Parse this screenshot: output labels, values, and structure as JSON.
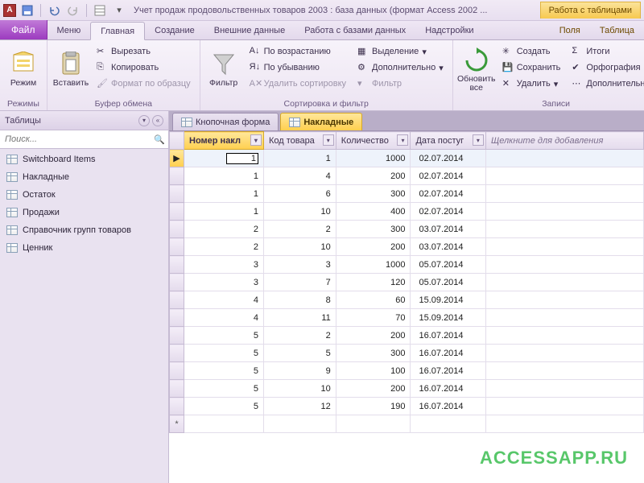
{
  "title": "Учет продаж продовольственных товаров 2003 : база данных (формат Access 2002 ...",
  "context_title": "Работа с таблицами",
  "tabs": {
    "file": "Файл",
    "items": [
      "Меню",
      "Главная",
      "Создание",
      "Внешние данные",
      "Работа с базами данных",
      "Надстройки"
    ],
    "context": [
      "Поля",
      "Таблица"
    ],
    "active": "Главная"
  },
  "ribbon": {
    "views": {
      "label": "Режимы",
      "btn": "Режим"
    },
    "clipboard": {
      "label": "Буфер обмена",
      "paste": "Вставить",
      "cut": "Вырезать",
      "copy": "Копировать",
      "format": "Формат по образцу"
    },
    "sortfilter": {
      "label": "Сортировка и фильтр",
      "filter": "Фильтр",
      "asc": "По возрастанию",
      "desc": "По убыванию",
      "clear": "Удалить сортировку",
      "selection": "Выделение",
      "advanced": "Дополнительно",
      "toggle": "Фильтр"
    },
    "records": {
      "label": "Записи",
      "refresh": "Обновить\nвсе",
      "new": "Создать",
      "save": "Сохранить",
      "delete": "Удалить",
      "totals": "Итоги",
      "spell": "Орфография",
      "more": "Дополнительно"
    }
  },
  "nav": {
    "header": "Таблицы",
    "search_placeholder": "Поиск...",
    "items": [
      "Switchboard Items",
      "Накладные",
      "Остаток",
      "Продажи",
      "Справочник групп товаров",
      "Ценник"
    ]
  },
  "doc_tabs": [
    {
      "label": "Кнопочная форма",
      "active": false
    },
    {
      "label": "Накладные",
      "active": true
    }
  ],
  "grid": {
    "columns": [
      "Номер накл",
      "Код товара",
      "Количество",
      "Дата постуг"
    ],
    "addcol": "Щелкните для добавления",
    "active_cell": "1",
    "rows": [
      [
        "",
        "1",
        "1000",
        "02.07.2014"
      ],
      [
        "1",
        "4",
        "200",
        "02.07.2014"
      ],
      [
        "1",
        "6",
        "300",
        "02.07.2014"
      ],
      [
        "1",
        "10",
        "400",
        "02.07.2014"
      ],
      [
        "2",
        "2",
        "300",
        "03.07.2014"
      ],
      [
        "2",
        "10",
        "200",
        "03.07.2014"
      ],
      [
        "3",
        "3",
        "1000",
        "05.07.2014"
      ],
      [
        "3",
        "7",
        "120",
        "05.07.2014"
      ],
      [
        "4",
        "8",
        "60",
        "15.09.2014"
      ],
      [
        "4",
        "11",
        "70",
        "15.09.2014"
      ],
      [
        "5",
        "2",
        "200",
        "16.07.2014"
      ],
      [
        "5",
        "5",
        "300",
        "16.07.2014"
      ],
      [
        "5",
        "9",
        "100",
        "16.07.2014"
      ],
      [
        "5",
        "10",
        "200",
        "16.07.2014"
      ],
      [
        "5",
        "12",
        "190",
        "16.07.2014"
      ]
    ]
  },
  "watermark": "ACCESSAPP.RU"
}
